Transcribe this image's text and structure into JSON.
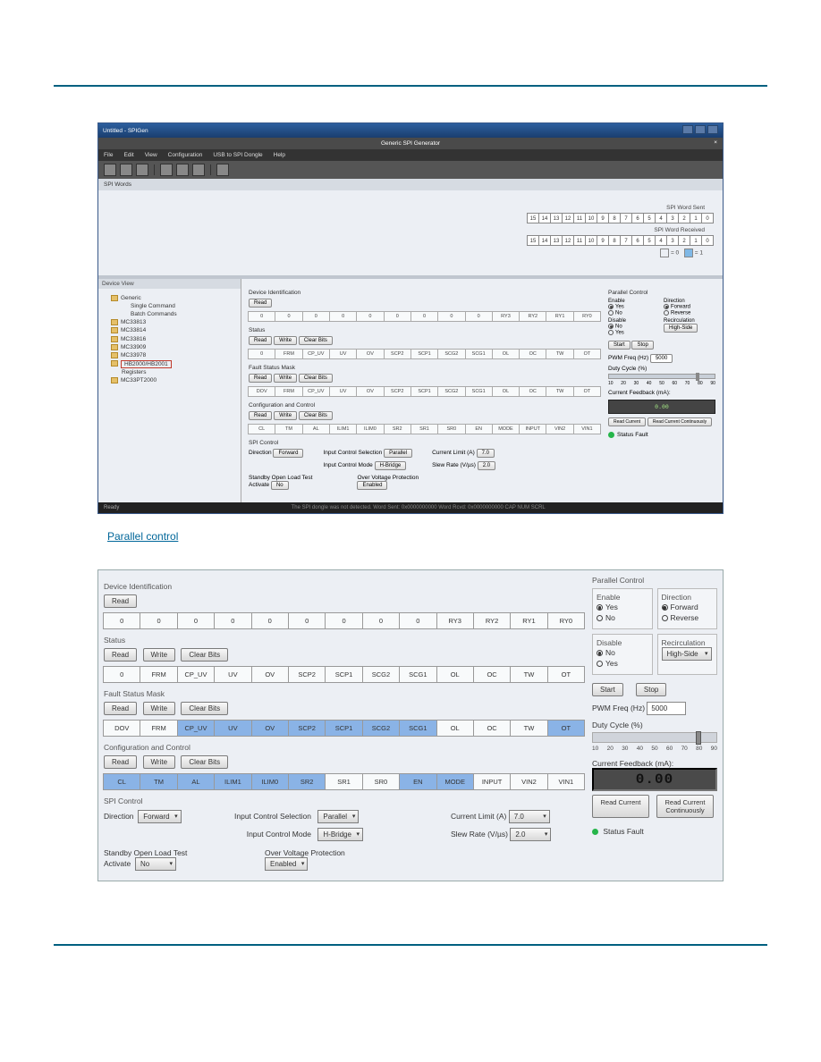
{
  "window": {
    "title": "Untitled - SPIGen",
    "subheader": "Generic SPI Generator",
    "menus": [
      "File",
      "Edit",
      "View",
      "Configuration",
      "USB to SPI Dongle",
      "Help"
    ]
  },
  "spi_words": {
    "tab_label": "SPI Words",
    "sent_label": "SPI Word Sent",
    "recv_label": "SPI Word Received",
    "bits": [
      "15",
      "14",
      "13",
      "12",
      "11",
      "10",
      "9",
      "8",
      "7",
      "6",
      "5",
      "4",
      "3",
      "2",
      "1",
      "0"
    ],
    "legend0": "= 0",
    "legend1": "= 1"
  },
  "tree": {
    "header": "Device View",
    "root": "",
    "generic": "Generic",
    "single": "Single Command",
    "batch": "Batch Commands",
    "n1": "MC33813",
    "n2": "MC33814",
    "n3": "MC33816",
    "n4": "MC33909",
    "n5": "MC33978",
    "selected": "HB2000/HB2001",
    "reg": "Registers",
    "n7": "MC33PT2000"
  },
  "groups": {
    "devid": "Device Identification",
    "status": "Status",
    "fsm": "Fault Status Mask",
    "cfg": "Configuration and Control",
    "spictrl": "SPI Control",
    "solt": "Standby Open Load Test",
    "ovp": "Over Voltage Protection",
    "parallel": "Parallel Control"
  },
  "btns": {
    "read": "Read",
    "write": "Write",
    "clear": "Clear Bits",
    "activate": "Activate",
    "start": "Start",
    "stop": "Stop",
    "readcur": "Read Current",
    "readcont": "Read Current Continuously"
  },
  "bits_status": [
    "0",
    "FRM",
    "CP_UV",
    "UV",
    "OV",
    "SCP2",
    "SCP1",
    "SCG2",
    "SCG1",
    "OL",
    "OC",
    "TW",
    "OT"
  ],
  "bits_fsm": [
    "DOV",
    "FRM",
    "CP_UV",
    "UV",
    "OV",
    "SCP2",
    "SCP1",
    "SCG2",
    "SCG1",
    "OL",
    "OC",
    "TW",
    "OT"
  ],
  "bits_cfg": [
    "CL",
    "TM",
    "AL",
    "ILIM1",
    "ILIM0",
    "SR2",
    "SR1",
    "SR0",
    "EN",
    "MODE",
    "INPUT",
    "VIN2",
    "VIN1"
  ],
  "bits_devid": [
    "0",
    "0",
    "0",
    "0",
    "0",
    "0",
    "0",
    "0",
    "0",
    "RY3",
    "RY2",
    "RY1",
    "RY0"
  ],
  "spi": {
    "direction_label": "Direction",
    "direction_val": "Forward",
    "ics_label": "Input Control Selection",
    "ics_val": "Parallel",
    "icm_label": "Input Control Mode",
    "icm_val": "H-Bridge",
    "cl_label": "Current Limit (A)",
    "cl_val": "7.0",
    "sr_label": "Slew Rate (V/µs)",
    "sr_val": "2.0",
    "solt_val": "No",
    "ovp_val": "Enabled"
  },
  "parallel": {
    "head": "Parallel Control",
    "enable_lbl": "Enable",
    "enable_yes": "Yes",
    "enable_no": "No",
    "disable_lbl": "Disable",
    "disable_no": "No",
    "disable_yes": "Yes",
    "dir_lbl": "Direction",
    "dir_fwd": "Forward",
    "dir_rev": "Reverse",
    "rec_lbl": "Recirculation",
    "rec_val": "High-Side",
    "pwm_lbl": "PWM Freq (Hz)",
    "pwm_val": "5000",
    "duty_lbl": "Duty Cycle (%)",
    "ticks": [
      "10",
      "20",
      "30",
      "40",
      "50",
      "60",
      "70",
      "80",
      "90"
    ],
    "cfb_lbl": "Current Feedback (mA):",
    "cfb_val": "0.00",
    "sf_lbl": "Status Fault"
  },
  "statusbar": "The SPI dongle was not detected.   Word Sent: 0x0000000000   Word Rcvd: 0x0000000000   CAP  NUM  SCRL",
  "ready": "Ready",
  "caption_link": "Parallel control"
}
